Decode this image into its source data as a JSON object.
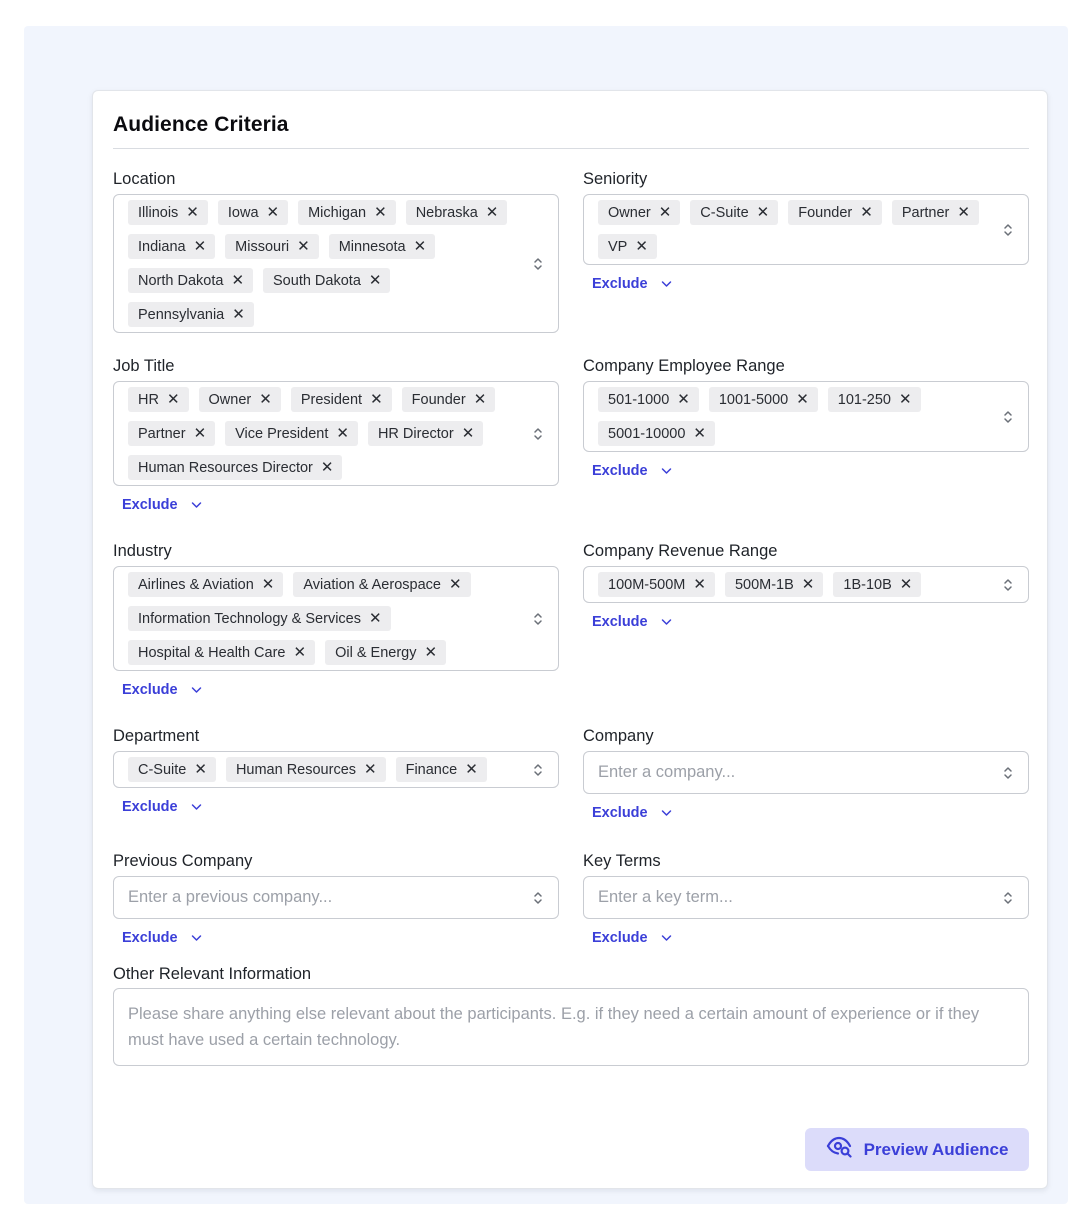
{
  "card": {
    "title": "Audience Criteria"
  },
  "exclude_label": "Exclude",
  "location": {
    "label": "Location",
    "chips": [
      "Illinois",
      "Iowa",
      "Michigan",
      "Nebraska",
      "Indiana",
      "Missouri",
      "Minnesota",
      "North Dakota",
      "South Dakota",
      "Pennsylvania"
    ]
  },
  "seniority": {
    "label": "Seniority",
    "chips": [
      "Owner",
      "C-Suite",
      "Founder",
      "Partner",
      "VP"
    ]
  },
  "job_title": {
    "label": "Job Title",
    "chips": [
      "HR",
      "Owner",
      "President",
      "Founder",
      "Partner",
      "Vice President",
      "HR Director",
      "Human Resources Director"
    ]
  },
  "employee_range": {
    "label": "Company Employee Range",
    "chips": [
      "501-1000",
      "1001-5000",
      "101-250",
      "5001-10000"
    ]
  },
  "industry": {
    "label": "Industry",
    "chips": [
      "Airlines & Aviation",
      "Aviation & Aerospace",
      "Information Technology & Services",
      "Hospital & Health Care",
      "Oil & Energy"
    ]
  },
  "revenue_range": {
    "label": "Company Revenue Range",
    "chips": [
      "100M-500M",
      "500M-1B",
      "1B-10B"
    ]
  },
  "department": {
    "label": "Department",
    "chips": [
      "C-Suite",
      "Human Resources",
      "Finance"
    ]
  },
  "company": {
    "label": "Company",
    "placeholder": "Enter a company..."
  },
  "previous_company": {
    "label": "Previous Company",
    "placeholder": "Enter a previous company..."
  },
  "key_terms": {
    "label": "Key Terms",
    "placeholder": "Enter a key term..."
  },
  "other_info": {
    "label": "Other Relevant Information",
    "placeholder": "Please share anything else relevant about the participants. E.g. if they need a certain amount of experience or if they must have used a certain technology."
  },
  "preview_button": {
    "label": "Preview Audience",
    "icon": "eye-search-icon"
  },
  "colors": {
    "accent": "#3b3fd8",
    "button_bg": "#dcdcfa",
    "page_bg": "#f1f5fd"
  }
}
